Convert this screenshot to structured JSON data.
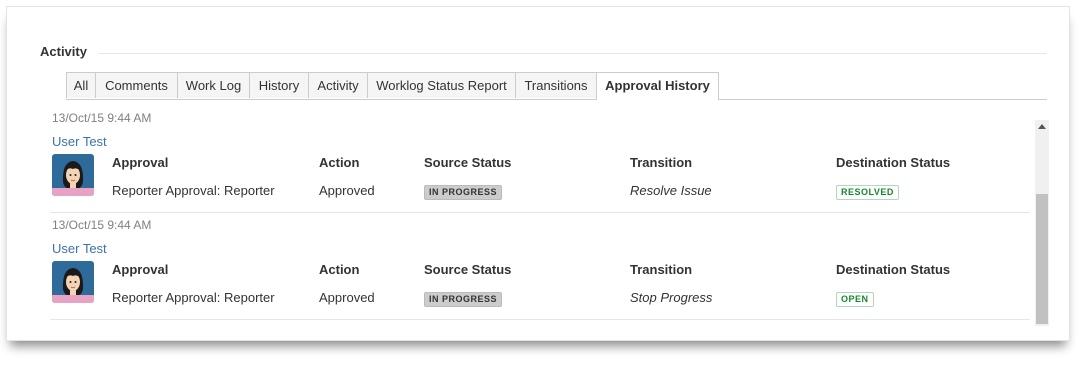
{
  "activity": {
    "title": "Activity"
  },
  "tabs": [
    {
      "label": "All"
    },
    {
      "label": "Comments"
    },
    {
      "label": "Work Log"
    },
    {
      "label": "History"
    },
    {
      "label": "Activity"
    },
    {
      "label": "Worklog Status Report"
    },
    {
      "label": "Transitions"
    },
    {
      "label": "Approval History",
      "active": true
    }
  ],
  "columns": {
    "approval": "Approval",
    "action": "Action",
    "source_status": "Source Status",
    "transition": "Transition",
    "destination_status": "Destination Status"
  },
  "entries": [
    {
      "date": "13/Oct/15 9:44 AM",
      "user": "User Test",
      "approval": "Reporter Approval: Reporter",
      "action": "Approved",
      "source_status": "IN PROGRESS",
      "transition": "Resolve Issue",
      "destination_status": "RESOLVED"
    },
    {
      "date": "13/Oct/15 9:44 AM",
      "user": "User Test",
      "approval": "Reporter Approval: Reporter",
      "action": "Approved",
      "source_status": "IN PROGRESS",
      "transition": "Stop Progress",
      "destination_status": "OPEN"
    }
  ],
  "colors": {
    "link": "#3b73af",
    "status_green": "#14892c",
    "status_grey": "#cccccc",
    "avatar_bg": "#2f6b9a"
  },
  "icons": {
    "avatar": "user-avatar-icon",
    "scroll_up": "scroll-up-icon"
  }
}
